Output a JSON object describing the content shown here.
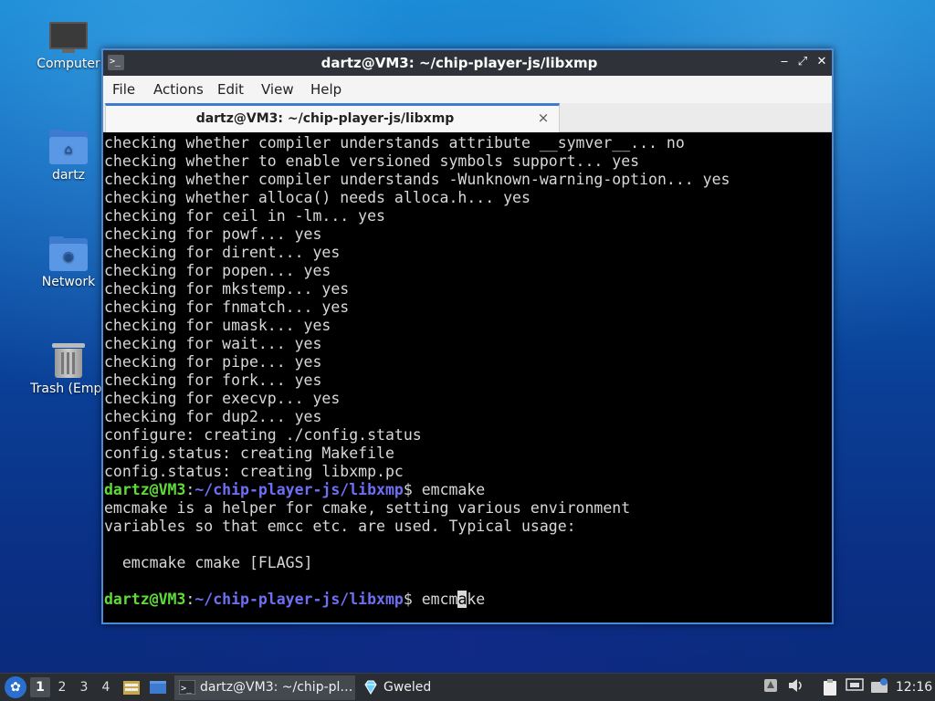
{
  "desktop": {
    "icons": [
      {
        "label": "Computer",
        "icon": "computer-icon"
      },
      {
        "label": "dartz",
        "icon": "home-folder-icon"
      },
      {
        "label": "Network",
        "icon": "network-folder-icon"
      },
      {
        "label": "Trash (Empt",
        "icon": "trash-icon"
      }
    ]
  },
  "window": {
    "title": "dartz@VM3: ~/chip-player-js/libxmp",
    "controls": {
      "minimize": "‒",
      "maximize": "⤢",
      "close": "✕"
    },
    "menu": [
      "File",
      "Actions",
      "Edit",
      "View",
      "Help"
    ],
    "tab": {
      "title": "dartz@VM3: ~/chip-player-js/libxmp",
      "close": "×"
    }
  },
  "terminal": {
    "output_lines": [
      "checking whether compiler understands attribute __symver__... no",
      "checking whether to enable versioned symbols support... yes",
      "checking whether compiler understands -Wunknown-warning-option... yes",
      "checking whether alloca() needs alloca.h... yes",
      "checking for ceil in -lm... yes",
      "checking for powf... yes",
      "checking for dirent... yes",
      "checking for popen... yes",
      "checking for mkstemp... yes",
      "checking for fnmatch... yes",
      "checking for umask... yes",
      "checking for wait... yes",
      "checking for pipe... yes",
      "checking for fork... yes",
      "checking for execvp... yes",
      "checking for dup2... yes",
      "configure: creating ./config.status",
      "config.status: creating Makefile",
      "config.status: creating libxmp.pc"
    ],
    "prompt_user": "dartz@VM3",
    "prompt_colon": ":",
    "prompt_path": "~/chip-player-js/libxmp",
    "prompt_symbol": "$",
    "command1": " emcmake",
    "help_lines": [
      "emcmake is a helper for cmake, setting various environment",
      "variables so that emcc etc. are used. Typical usage:",
      "",
      "  emcmake cmake [FLAGS]",
      ""
    ],
    "current_input_before": " emcm",
    "current_input_cursor": "a",
    "current_input_after": "ke"
  },
  "taskbar": {
    "workspaces": [
      "1",
      "2",
      "3",
      "4"
    ],
    "active_workspace": "1",
    "tasks": [
      {
        "label": "dartz@VM3: ~/chip-pl…",
        "icon": "terminal-icon",
        "active": true
      },
      {
        "label": "Gweled",
        "icon": "gem-icon",
        "active": false
      }
    ],
    "clock": "12:16"
  },
  "colors": {
    "prompt_user": "#5fdc38",
    "prompt_path": "#6f6ff5",
    "accent": "#3d7ad0",
    "terminal_bg": "#000000",
    "terminal_fg": "#d8d8d8"
  }
}
